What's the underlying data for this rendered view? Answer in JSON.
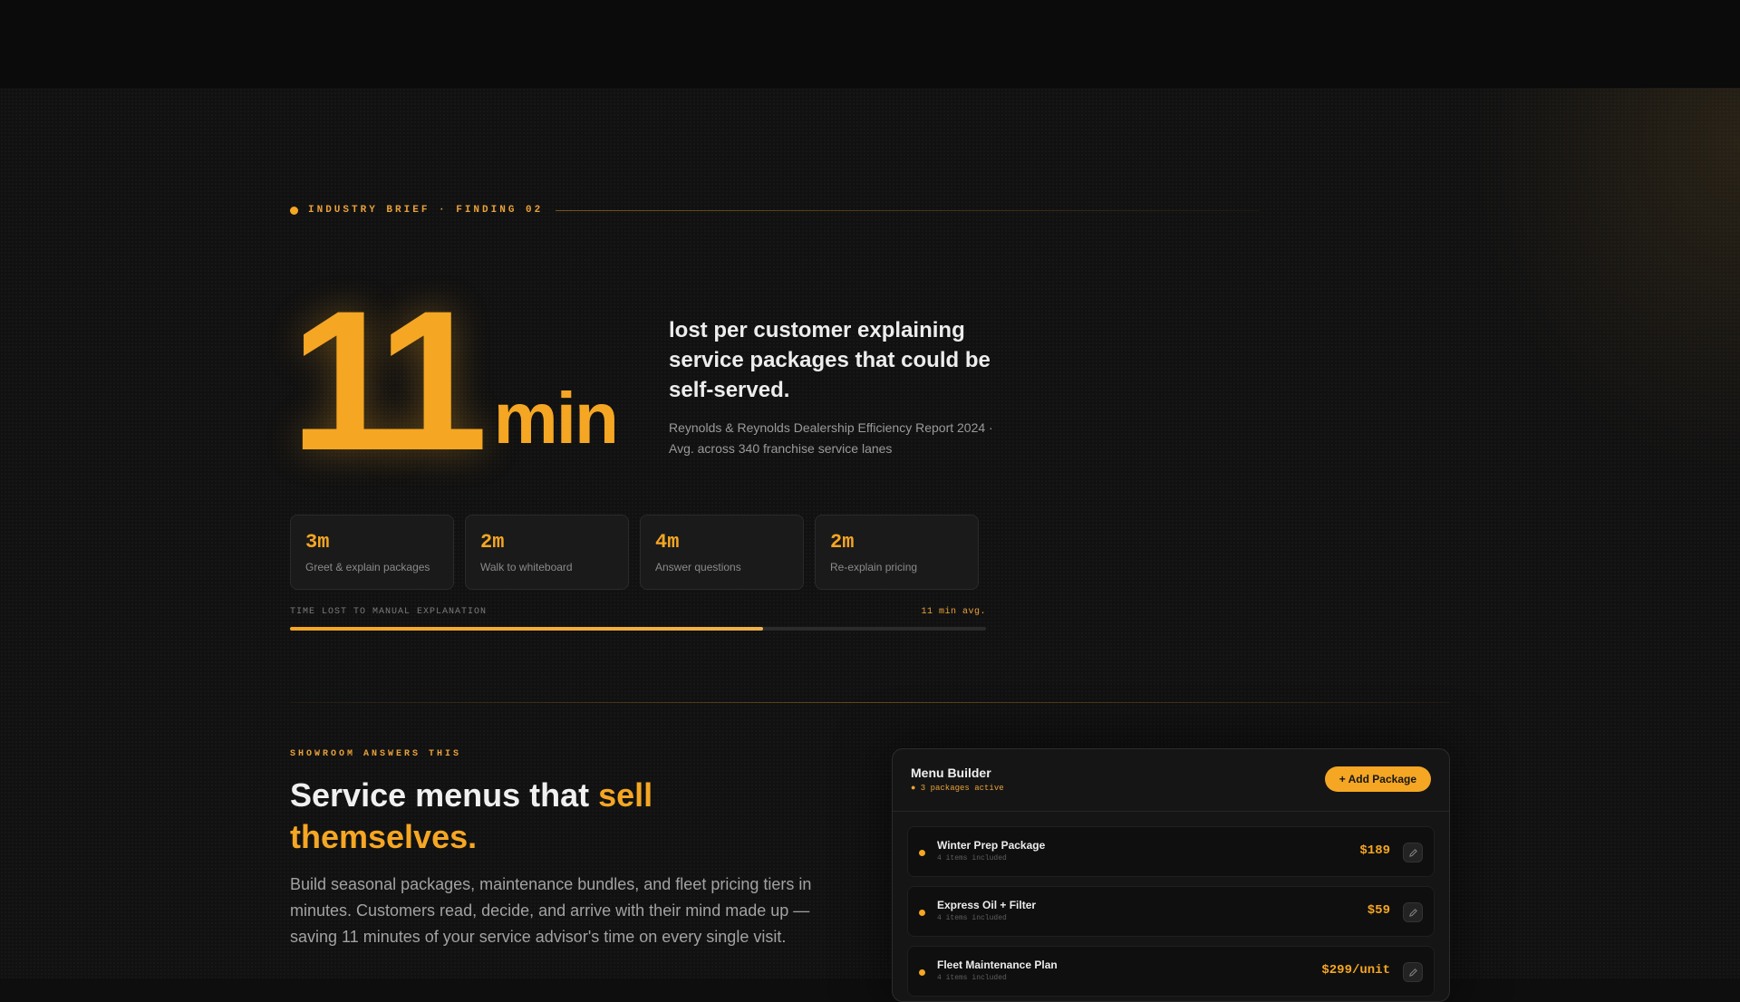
{
  "brief": {
    "eyebrow": "INDUSTRY BRIEF · FINDING 02"
  },
  "hero": {
    "number": "11",
    "unit": "min",
    "headline": "lost per customer explaining service packages that could be self-served.",
    "source": "Reynolds & Reynolds Dealership Efficiency Report 2024 · Avg. across 340 franchise service lanes"
  },
  "stats": [
    {
      "value": "3m",
      "label": "Greet & explain packages"
    },
    {
      "value": "2m",
      "label": "Walk to whiteboard"
    },
    {
      "value": "4m",
      "label": "Answer questions"
    },
    {
      "value": "2m",
      "label": "Re-explain pricing"
    }
  ],
  "progress": {
    "label": "TIME LOST TO MANUAL EXPLANATION",
    "value_text": "11 min avg.",
    "fill_fraction": 0.68
  },
  "section": {
    "eyebrow": "SHOWROOM ANSWERS THIS",
    "title_prefix": "Service menus that ",
    "title_accent": "sell themselves.",
    "body": "Build seasonal packages, maintenance bundles, and fleet pricing tiers in minutes. Customers read, decide, and arrive with their mind made up — saving 11 minutes of your service advisor's time on every single visit."
  },
  "menu_builder": {
    "title": "Menu Builder",
    "status": "● 3 packages active",
    "add_label": "+ Add Package",
    "packages": [
      {
        "name": "Winter Prep Package",
        "items": "4 items included",
        "price": "$189"
      },
      {
        "name": "Express Oil + Filter",
        "items": "4 items included",
        "price": "$59"
      },
      {
        "name": "Fleet Maintenance Plan",
        "items": "4 items included",
        "price": "$299/unit"
      }
    ]
  },
  "colors": {
    "accent": "#f5a623",
    "background": "#111111",
    "card": "#1a1a1a"
  }
}
